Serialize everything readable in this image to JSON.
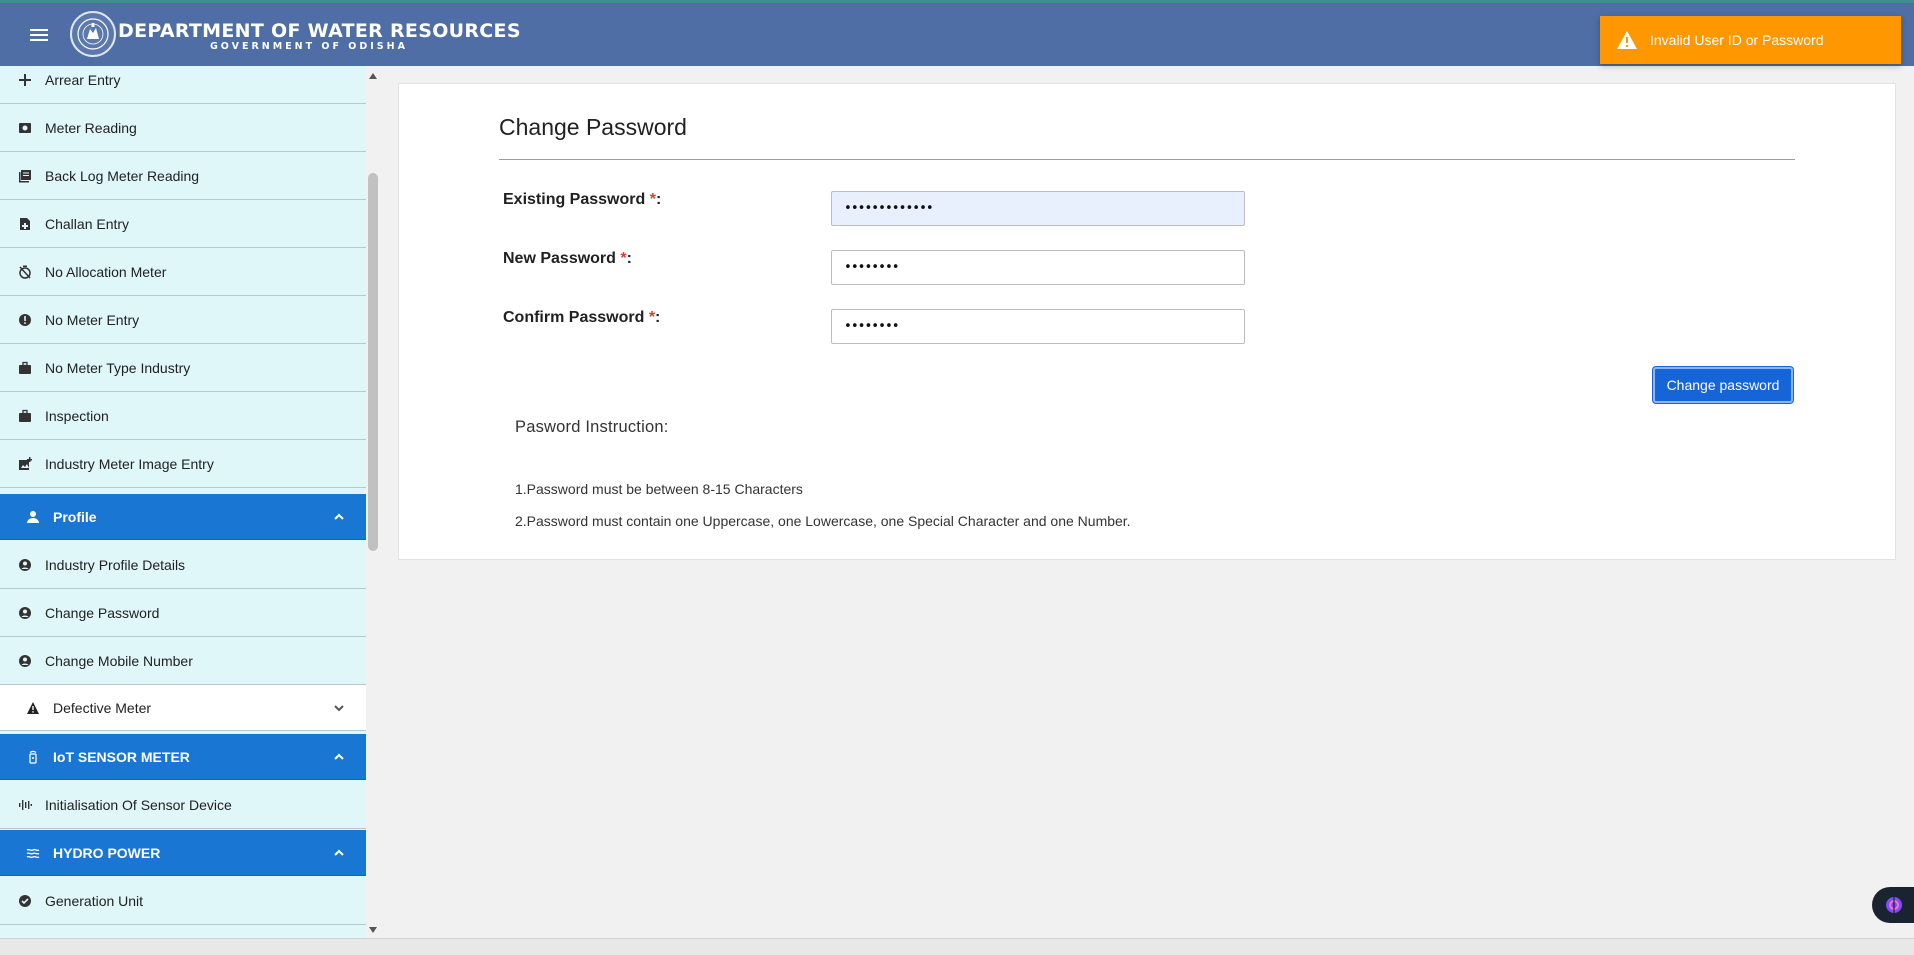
{
  "header": {
    "title": "DEPARTMENT OF WATER RESOURCES",
    "subtitle": "GOVERNMENT OF ODISHA"
  },
  "toast": {
    "message": "Invalid User ID or Password",
    "icon": "warning-icon",
    "color": "#ff9800"
  },
  "sidebar": {
    "items": [
      {
        "label": "Arrear Entry",
        "icon": "plus-icon"
      },
      {
        "label": "Meter Reading",
        "icon": "image-search-icon"
      },
      {
        "label": "Back Log Meter Reading",
        "icon": "library-books-icon"
      },
      {
        "label": "Challan Entry",
        "icon": "note-add-icon"
      },
      {
        "label": "No Allocation Meter",
        "icon": "timer-off-icon"
      },
      {
        "label": "No Meter Entry",
        "icon": "error-icon"
      },
      {
        "label": "No Meter Type Industry",
        "icon": "briefcase-icon"
      },
      {
        "label": "Inspection",
        "icon": "briefcase-icon"
      },
      {
        "label": "Industry Meter Image Entry",
        "icon": "add-photo-icon"
      }
    ],
    "profile_section": {
      "label": "Profile",
      "icon": "person-icon"
    },
    "profile_items": [
      {
        "label": "Industry Profile Details",
        "icon": "account-circle-icon"
      },
      {
        "label": "Change Password",
        "icon": "account-circle-icon"
      },
      {
        "label": "Change Mobile Number",
        "icon": "account-circle-icon"
      }
    ],
    "defective_section": {
      "label": "Defective Meter",
      "icon": "warning-icon"
    },
    "iot_section": {
      "label": "IoT SENSOR METER",
      "icon": "sensor-icon"
    },
    "iot_items": [
      {
        "label": "Initialisation Of Sensor Device",
        "icon": "graphic-eq-icon"
      }
    ],
    "hydro_section": {
      "label": "HYDRO POWER",
      "icon": "waves-icon"
    },
    "hydro_items": [
      {
        "label": "Generation Unit",
        "icon": "check-circle-icon"
      }
    ],
    "accent": "#1976d2",
    "background": "#e0f7fa"
  },
  "form": {
    "title": "Change Password",
    "required_mark": "*",
    "colon": ":",
    "existing": {
      "label": "Existing Password ",
      "value": "•••••••••••••"
    },
    "new": {
      "label": "New Password ",
      "value": "••••••••"
    },
    "confirm": {
      "label": "Confirm Password ",
      "value": "••••••••"
    },
    "submit_label": "Change password"
  },
  "instructions": {
    "title": "Pasword Instruction:",
    "lines": [
      "1.Password must be between 8-15 Characters",
      "2.Password must contain one Uppercase, one Lowercase, one Special Character and one Number."
    ]
  }
}
